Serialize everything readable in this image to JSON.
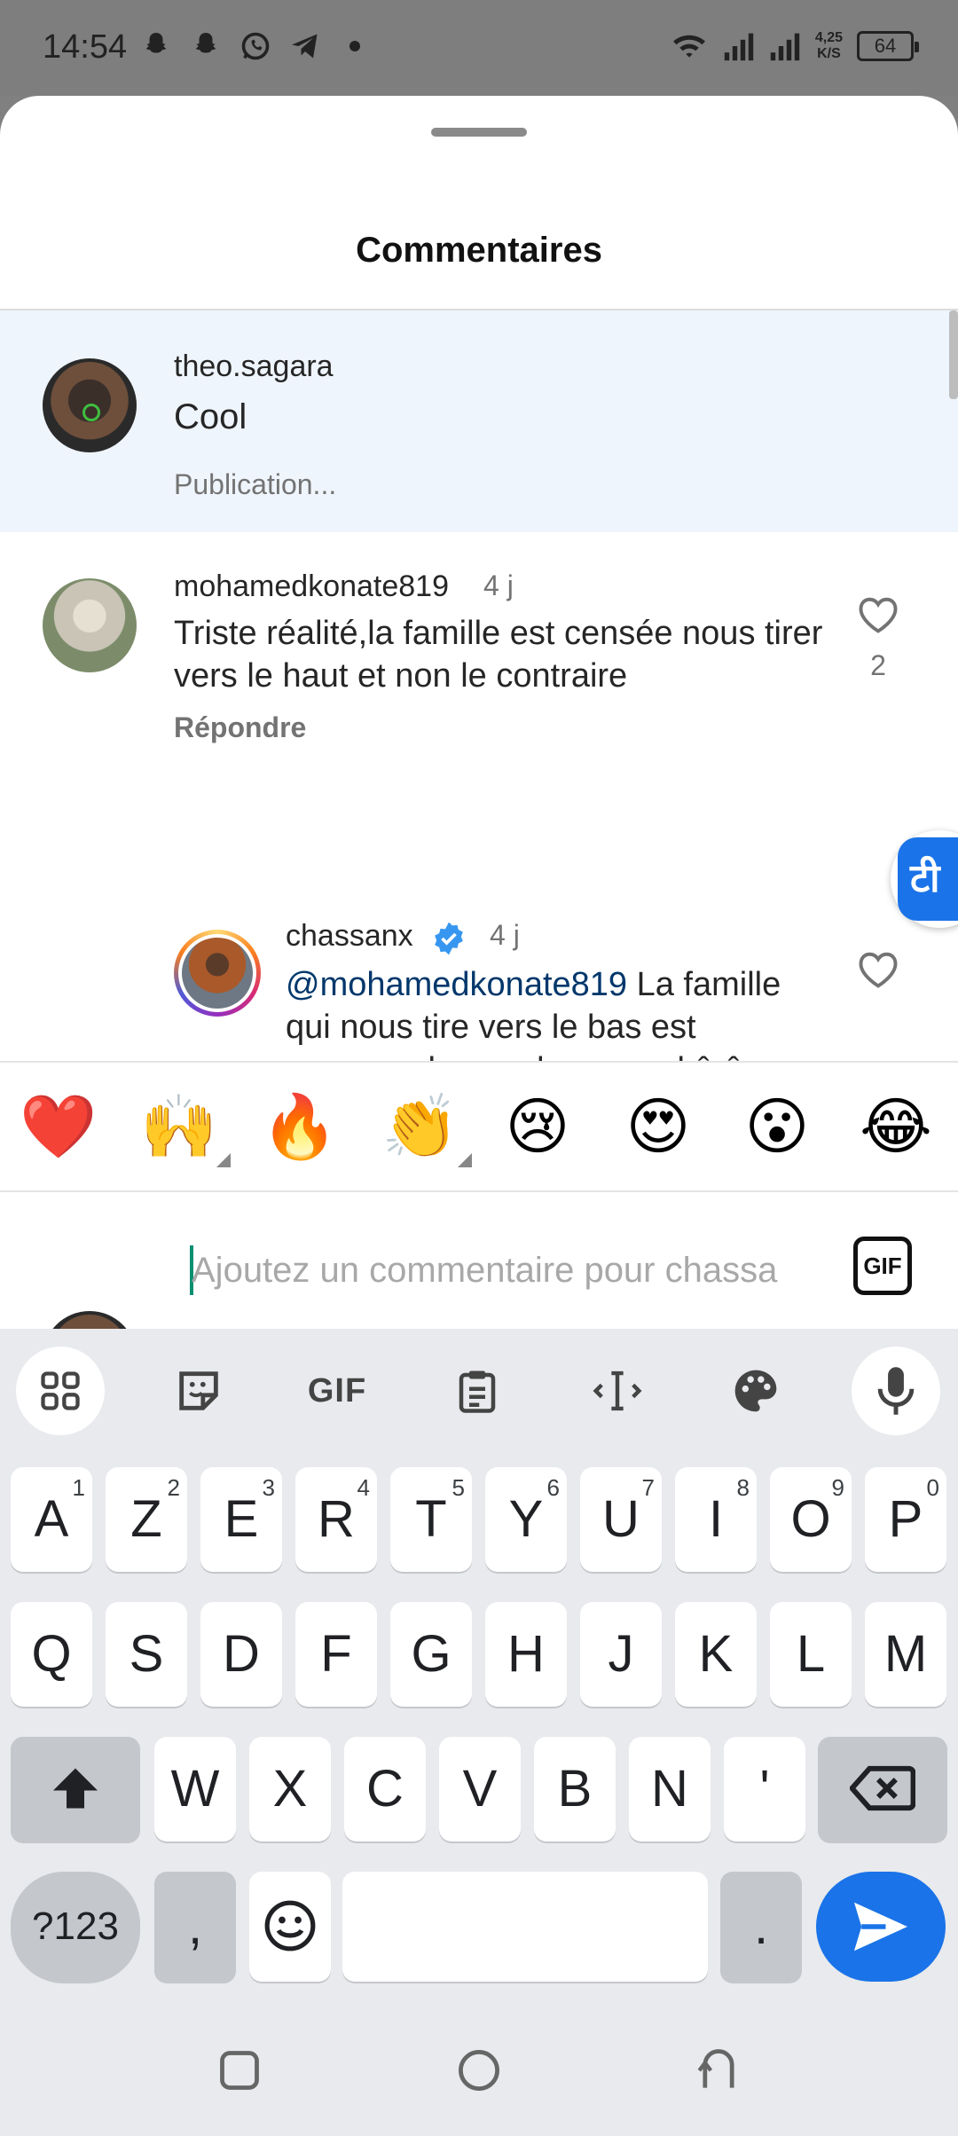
{
  "status_bar": {
    "time": "14:54",
    "network_speed_value": "4,25",
    "network_speed_unit": "K/S",
    "battery": "64"
  },
  "sheet": {
    "title": "Commentaires"
  },
  "comments": [
    {
      "username": "theo.sagara",
      "text": "Cool",
      "meta": "Publication..."
    },
    {
      "username": "mohamedkonate819",
      "age": "4 j",
      "text": "Triste réalité,la famille est censée nous tirer vers le haut et non le contraire",
      "reply_label": "Répondre",
      "likes": "2"
    },
    {
      "username": "chassanx",
      "age": "4 j",
      "mention": "@mohamedkonate819",
      "text": " La famille qui nous tire vers le bas est presque devenu la norme kôrô."
    }
  ],
  "translate_fab": {
    "glyph": "टी"
  },
  "emoji_bar": [
    "❤️",
    "🙌",
    "🔥",
    "👏",
    "😢",
    "😍",
    "😮",
    "😂"
  ],
  "comment_input": {
    "placeholder": "Ajoutez un commentaire pour chassa",
    "gif_label": "GIF"
  },
  "keyboard": {
    "toolbar": {
      "gif_label": "GIF"
    },
    "row1": [
      {
        "k": "A",
        "n": "1"
      },
      {
        "k": "Z",
        "n": "2"
      },
      {
        "k": "E",
        "n": "3"
      },
      {
        "k": "R",
        "n": "4"
      },
      {
        "k": "T",
        "n": "5"
      },
      {
        "k": "Y",
        "n": "6"
      },
      {
        "k": "U",
        "n": "7"
      },
      {
        "k": "I",
        "n": "8"
      },
      {
        "k": "O",
        "n": "9"
      },
      {
        "k": "P",
        "n": "0"
      }
    ],
    "row2": [
      "Q",
      "S",
      "D",
      "F",
      "G",
      "H",
      "J",
      "K",
      "L",
      "M"
    ],
    "row3": [
      "W",
      "X",
      "C",
      "V",
      "B",
      "N",
      "'"
    ],
    "symbols_label": "?123",
    "comma": ",",
    "period": "."
  }
}
